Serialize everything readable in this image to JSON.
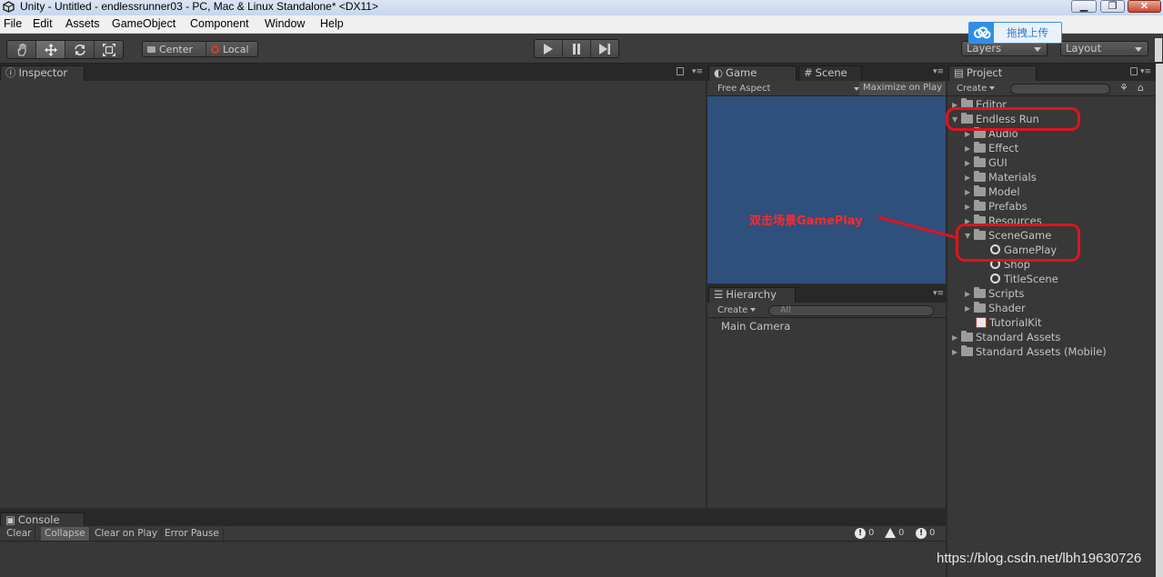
{
  "window": {
    "title": "Unity - Untitled - endlessrunner03 - PC, Mac & Linux Standalone* <DX11>",
    "min_label": "▁",
    "max_label": "❐",
    "close_label": "✕"
  },
  "menu": [
    "File",
    "Edit",
    "Assets",
    "GameObject",
    "Component",
    "Window",
    "Help"
  ],
  "toolbar": {
    "pivot_center": "Center",
    "pivot_local": "Local",
    "layers": "Layers",
    "layout": "Layout",
    "upload_label": "拖拽上传"
  },
  "inspector": {
    "tab": "Inspector"
  },
  "game": {
    "tab": "Game",
    "scene_tab": "Scene",
    "aspect": "Free Aspect",
    "maximize": "Maximize on Play",
    "viewport_color": "#2f4f7d"
  },
  "hierarchy": {
    "tab": "Hierarchy",
    "create": "Create",
    "search_placeholder": "All",
    "items": [
      "Main Camera"
    ]
  },
  "project": {
    "tab": "Project",
    "create": "Create",
    "tree": [
      {
        "label": "Editor",
        "depth": 0,
        "type": "folder",
        "expanded": false
      },
      {
        "label": "Endless Run",
        "depth": 0,
        "type": "folder",
        "expanded": true
      },
      {
        "label": "Audio",
        "depth": 1,
        "type": "folder",
        "expanded": false
      },
      {
        "label": "Effect",
        "depth": 1,
        "type": "folder",
        "expanded": false
      },
      {
        "label": "GUI",
        "depth": 1,
        "type": "folder",
        "expanded": false
      },
      {
        "label": "Materials",
        "depth": 1,
        "type": "folder",
        "expanded": false
      },
      {
        "label": "Model",
        "depth": 1,
        "type": "folder",
        "expanded": false
      },
      {
        "label": "Prefabs",
        "depth": 1,
        "type": "folder",
        "expanded": false
      },
      {
        "label": "Resources",
        "depth": 1,
        "type": "folder",
        "expanded": false
      },
      {
        "label": "SceneGame",
        "depth": 1,
        "type": "folder",
        "expanded": true
      },
      {
        "label": "GamePlay",
        "depth": 2,
        "type": "scene"
      },
      {
        "label": "Shop",
        "depth": 2,
        "type": "scene"
      },
      {
        "label": "TitleScene",
        "depth": 2,
        "type": "scene"
      },
      {
        "label": "Scripts",
        "depth": 1,
        "type": "folder",
        "expanded": false
      },
      {
        "label": "Shader",
        "depth": 1,
        "type": "folder",
        "expanded": false
      },
      {
        "label": "TutorialKit",
        "depth": 1,
        "type": "kit"
      },
      {
        "label": "Standard Assets",
        "depth": 0,
        "type": "folder",
        "expanded": false
      },
      {
        "label": "Standard Assets (Mobile)",
        "depth": 0,
        "type": "folder",
        "expanded": false
      }
    ]
  },
  "console": {
    "tab": "Console",
    "clear": "Clear",
    "collapse": "Collapse",
    "clear_on_play": "Clear on Play",
    "error_pause": "Error Pause",
    "info_count": "0",
    "warn_count": "0",
    "error_count": "0"
  },
  "annotation": {
    "text": "双击场景GamePlay",
    "color": "#e0141e"
  },
  "watermark": "https://blog.csdn.net/lbh19630726"
}
